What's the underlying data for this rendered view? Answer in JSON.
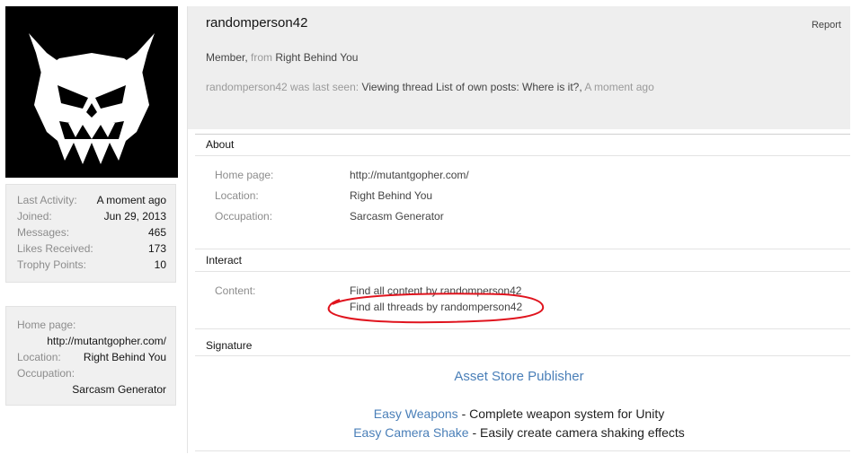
{
  "avatar": {
    "icon": "demon-skull-icon",
    "colors": {
      "background": "#000000",
      "figure": "#ffffff"
    }
  },
  "stats": [
    {
      "label": "Last Activity:",
      "value": "A moment ago"
    },
    {
      "label": "Joined:",
      "value": "Jun 29, 2013"
    },
    {
      "label": "Messages:",
      "value": "465"
    },
    {
      "label": "Likes Received:",
      "value": "173"
    },
    {
      "label": "Trophy Points:",
      "value": "10"
    }
  ],
  "sidebar_info": {
    "home_label": "Home page:",
    "home_value": "http://mutantgopher.com/",
    "location_label": "Location:",
    "location_value": "Right Behind You",
    "occupation_label": "Occupation:",
    "occupation_value": "Sarcasm Generator"
  },
  "profile": {
    "username": "randomperson42",
    "report": "Report",
    "member_title": "Member,",
    "from_word": "from",
    "location_link": "Right Behind You",
    "lastseen_prefix": "randomperson42 was last seen:",
    "lastseen_activity": "Viewing thread List of own posts: Where is it?,",
    "lastseen_time": "A moment ago"
  },
  "about": {
    "title": "About",
    "home_label": "Home page:",
    "home_value": "http://mutantgopher.com/",
    "location_label": "Location:",
    "location_value": "Right Behind You",
    "occupation_label": "Occupation:",
    "occupation_value": "Sarcasm Generator"
  },
  "interact": {
    "title": "Interact",
    "content_label": "Content:",
    "find_content": "Find all content by randomperson42",
    "find_threads": "Find all threads by randomperson42",
    "highlight_color": "#e0141e"
  },
  "signature": {
    "title": "Signature",
    "publisher_link": "Asset Store Publisher",
    "line1_link": "Easy Weapons",
    "line1_text": " - Complete weapon system for Unity",
    "line2_link": "Easy Camera Shake",
    "line2_text": " - Easily create camera shaking effects",
    "link_color": "#4a7fb8"
  }
}
